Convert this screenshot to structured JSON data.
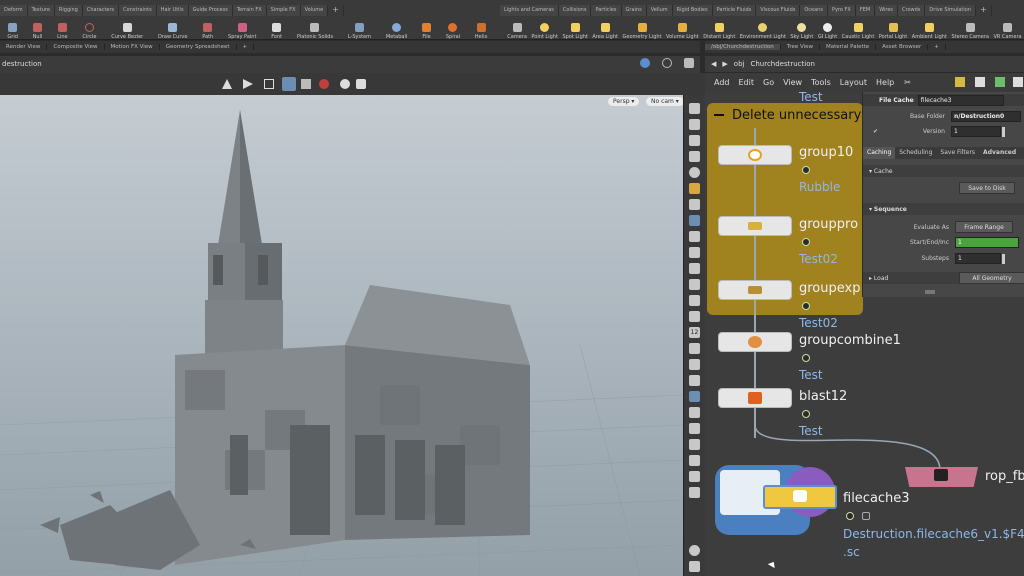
{
  "shelf": {
    "tabs_left": [
      "Deform",
      "Texture",
      "Rigging",
      "Characters",
      "Constraints",
      "Hair Utils",
      "Guide Process",
      "Terrain FX",
      "Simple FX",
      "Volume"
    ],
    "tabs_right": [
      "Lights and Cameras",
      "Collisions",
      "Particles",
      "Grains",
      "Vellum",
      "Rigid Bodies",
      "Particle Fluids",
      "Viscous Fluids",
      "Oceans",
      "Pyro FX",
      "FEM",
      "Wires",
      "Crowds",
      "Drive Simulation"
    ],
    "tools_left": [
      "Grid",
      "Null",
      "Line",
      "Circle",
      "Curve Bezier",
      "Draw Curve",
      "Path",
      "Spray Paint",
      "Font",
      "Platonic Solids",
      "L-System",
      "Metaball",
      "File",
      "Spiral",
      "Helix"
    ],
    "tools_right": [
      "Camera",
      "Point Light",
      "Spot Light",
      "Area Light",
      "Geometry Light",
      "Volume Light",
      "Distant Light",
      "Environment Light",
      "Sky Light",
      "GI Light",
      "Caustic Light",
      "Portal Light",
      "Ambient Light",
      "Stereo Camera",
      "VR Camera"
    ]
  },
  "pane_tabs_left": [
    "Render View",
    "Composite View",
    "Motion FX View",
    "Geometry Spreadsheet"
  ],
  "pane_tabs_right": [
    "/obj/Churchdestruction",
    "Tree View",
    "Material Palette",
    "Asset Browser"
  ],
  "viewport": {
    "path": "destruction",
    "persp_label": "Persp ▾",
    "cam_label": "No cam ▾"
  },
  "network": {
    "path_obj": "obj",
    "path_node": "Churchdestruction",
    "menu": [
      "Add",
      "Edit",
      "Go",
      "View",
      "Tools",
      "Layout",
      "Help"
    ],
    "box_title": "Delete unnecessary",
    "top_label": "Test",
    "nodes": [
      {
        "name": "group10",
        "sub": "Rubble"
      },
      {
        "name": "grouppro",
        "sub": "Test02"
      },
      {
        "name": "groupexp",
        "sub": "Test02"
      },
      {
        "name": "groupcombine1",
        "sub": "Test"
      },
      {
        "name": "blast12",
        "sub": "Test"
      }
    ],
    "filecache_name": "filecache3",
    "filecache_path": "Destruction.filecache6_v1.$F4",
    "filecache_path2": ".sc",
    "rop_name": "rop_fb"
  },
  "params": {
    "type": "File Cache",
    "node_name": "filecache3",
    "base_folder_label": "Base Folder",
    "base_folder_value": "n/Destruction0",
    "version_label": "Version",
    "version_value": "1",
    "tabs": [
      "Caching",
      "Scheduling",
      "Save Filters",
      "Advanced"
    ],
    "section_cache": "Cache",
    "save_to_disk": "Save to Disk",
    "section_sequence": "Sequence",
    "evaluate_as_label": "Evaluate As",
    "evaluate_as_value": "Frame Range",
    "start_end_label": "Start/End/Inc",
    "start_value": "1",
    "substeps_label": "Substeps",
    "substeps_value": "1",
    "load_label": "Load",
    "load_value": "All Geometry"
  },
  "colors": {
    "netbox": "#a5861d",
    "node_label": "#f0f0f0",
    "subtext": "#8fb8e6",
    "highlight_field": "#4aa33c"
  }
}
